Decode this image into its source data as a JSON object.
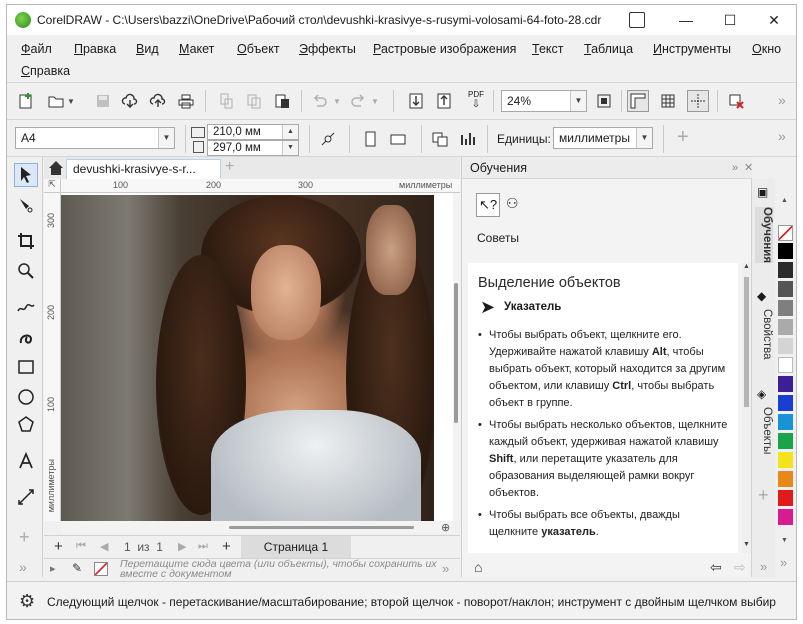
{
  "window": {
    "title": "CorelDRAW - C:\\Users\\bazzi\\OneDrive\\Рабочий стол\\devushki-krasivye-s-rusymi-volosami-64-foto-28.cdr",
    "minimize": "—",
    "maximize": "☐",
    "close": "✕"
  },
  "menu": {
    "items": [
      "Файл",
      "Правка",
      "Вид",
      "Макет",
      "Объект",
      "Эффекты",
      "Растровые изображения",
      "Текст",
      "Таблица",
      "Инструменты",
      "Окно",
      "Справка"
    ]
  },
  "toolbar": {
    "zoom_value": "24%",
    "pdf_label": "PDF"
  },
  "property_bar": {
    "page_size": "A4",
    "width": "210,0 мм",
    "height": "297,0 мм",
    "units_label": "Единицы:",
    "units_value": "миллиметры"
  },
  "document": {
    "tab_label": "devushki-krasivye-s-r...",
    "ruler_h_ticks": [
      "100",
      "200",
      "300"
    ],
    "ruler_h_unit": "миллиметры",
    "ruler_v_ticks": [
      "300",
      "200",
      "100"
    ],
    "ruler_v_unit": "миллиметры",
    "page_counter": "1  из  1",
    "page_tab": "Страница 1",
    "color_hint": "Перетащите сюда цвета (или объекты), чтобы сохранить их вместе с документом"
  },
  "docker": {
    "title": "Обучения",
    "section": "Советы",
    "tip_title": "Выделение объектов",
    "tip_tool": "Указатель",
    "bullets": [
      {
        "before": "Чтобы выбрать объект, щелкните его. Удерживайте нажатой клавишу ",
        "key": "Alt",
        "after": ", чтобы выбрать объект, который находится за другим объектом, или клавишу ",
        "key2": "Ctrl",
        "after2": ", чтобы выбрать объект в группе."
      },
      {
        "before": "Чтобы выбрать несколько объектов, щелкните каждый объект, удерживая нажатой клавишу ",
        "key": "Shift",
        "after": ", или перетащите указатель для образования выделяющей рамки вокруг объектов.",
        "key2": "",
        "after2": ""
      },
      {
        "before": "Чтобы выбрать все объекты, дважды щелкните ",
        "key": "указатель",
        "after": ".",
        "key2": "",
        "after2": ""
      }
    ],
    "side_tabs": [
      "Обучения",
      "Свойства",
      "Объекты"
    ]
  },
  "palette": {
    "colors": [
      "#000000",
      "#2b2b2b",
      "#555555",
      "#7f7f7f",
      "#aaaaaa",
      "#d4d4d4",
      "#ffffff",
      "#3c1f97",
      "#1a3fd0",
      "#1a93d6",
      "#19a34a",
      "#f3e21c",
      "#e8871a",
      "#e01b1b",
      "#d81b8e"
    ]
  },
  "status": {
    "text": "Следующий щелчок - перетаскивание/масштабирование; второй щелчок - поворот/наклон; инструмент с двойным щелчком выбир"
  }
}
